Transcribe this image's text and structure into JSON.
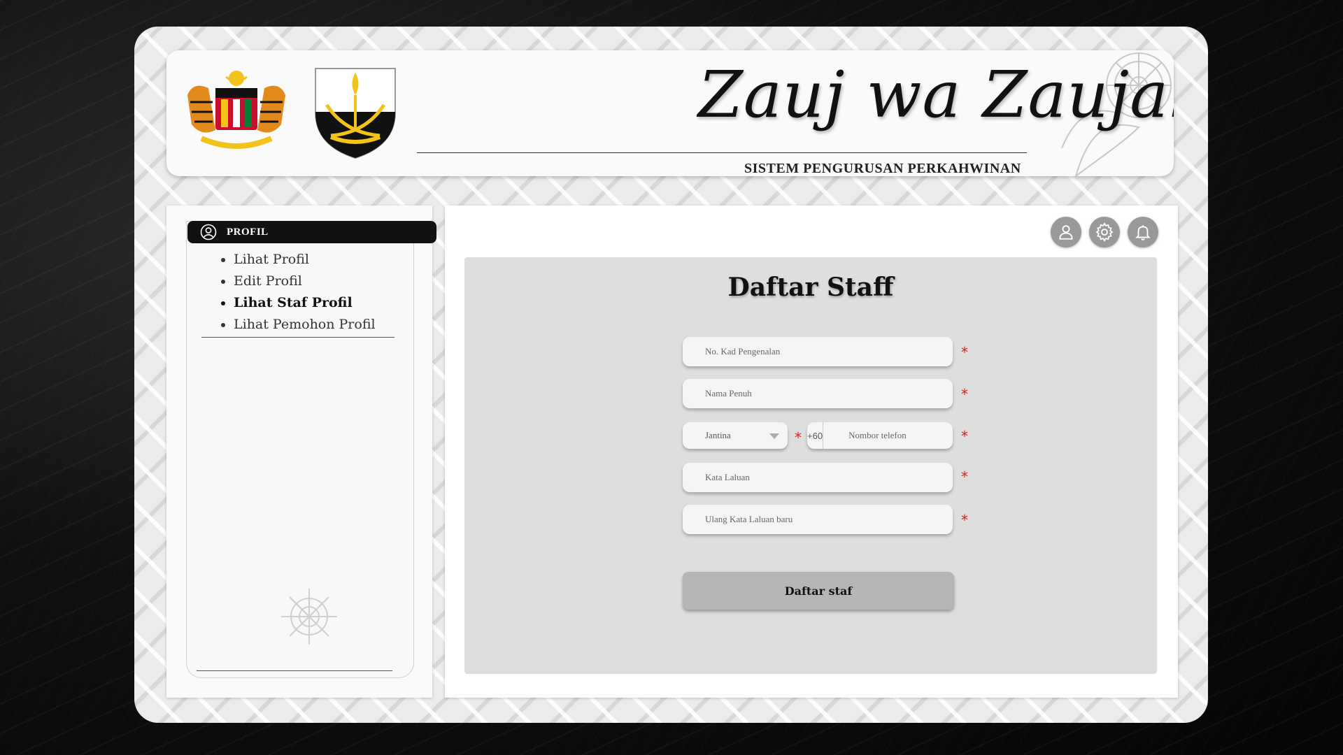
{
  "header": {
    "title": "Zauj wa Zaujah",
    "subtitle": "SISTEM PENGURUSAN PERKAHWINAN"
  },
  "sidebar": {
    "section_label": "PROFIL",
    "section_icon": "user-circle-icon",
    "items": [
      {
        "label": "Lihat Profil",
        "active": false
      },
      {
        "label": "Edit Profil",
        "active": false
      },
      {
        "label": "Lihat Staf Profil",
        "active": true
      },
      {
        "label": "Lihat Pemohon Profil",
        "active": false
      }
    ]
  },
  "toolbar": {
    "icons": [
      "user-icon",
      "gear-icon",
      "bell-icon"
    ]
  },
  "form": {
    "title": "Daftar Staff",
    "required_mark": "*",
    "ic_placeholder": "No. Kad Pengenalan",
    "name_placeholder": "Nama Penuh",
    "gender_placeholder": "Jantina",
    "phone_prefix": "+60",
    "phone_placeholder": "Nombor telefon",
    "password_placeholder": "Kata Laluan",
    "confirm_password_placeholder": "Ulang Kata Laluan baru",
    "submit_label": "Daftar staf"
  },
  "colors": {
    "accent": "#111111",
    "required": "#e21b1b",
    "form_bg": "#dedede",
    "button_bg": "#b5b5b5"
  }
}
